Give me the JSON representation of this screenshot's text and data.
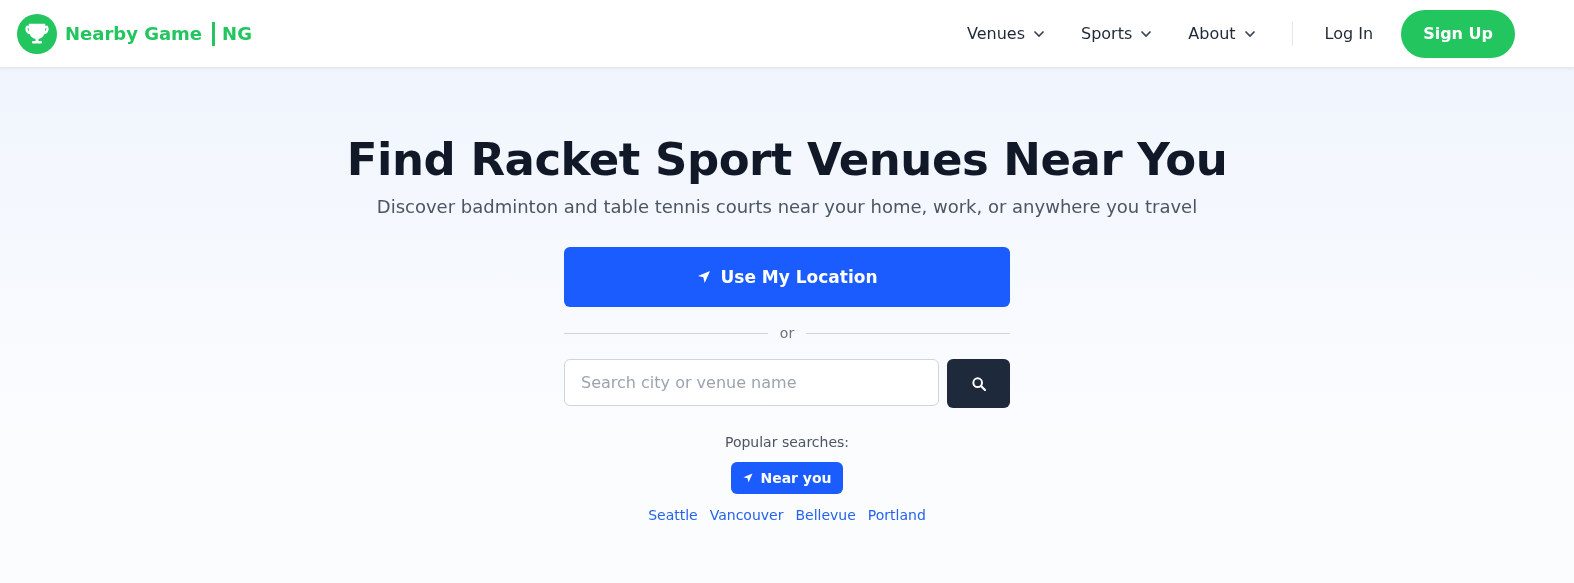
{
  "brand": {
    "name": "Nearby Game",
    "short": "NG"
  },
  "nav": [
    {
      "label": "Venues",
      "kind": "menu"
    },
    {
      "label": "Sports",
      "kind": "menu"
    },
    {
      "label": "About",
      "kind": "menu"
    },
    {
      "label": "Log In",
      "kind": "link"
    },
    {
      "label": "Sign Up",
      "kind": "button"
    }
  ],
  "hero": {
    "title": "Find Racket Sport Venues Near You",
    "subtitle": "Discover badminton and table tennis courts near your home, work, or anywhere you travel",
    "location_button": "Use My Location",
    "divider": "or",
    "search": {
      "placeholder": "Search city or venue name"
    }
  },
  "popular": {
    "label": "Popular searches:",
    "near_button": "Near you",
    "cities": [
      "Seattle",
      "Vancouver",
      "Bellevue",
      "Portland"
    ]
  }
}
